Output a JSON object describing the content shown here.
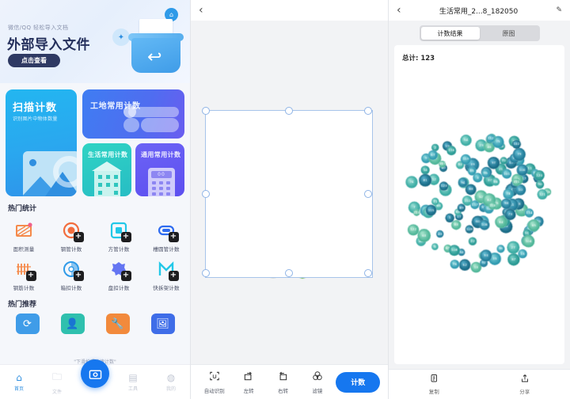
{
  "panel1": {
    "banner": {
      "subtitle": "微信/QQ 轻松导入文档",
      "title": "外部导入文件",
      "button": "点击查看",
      "art_icons": {
        "bubble_small": "✦",
        "bubble_doc": "⌂",
        "arrow": "↩"
      }
    },
    "cards": [
      {
        "id": "scan",
        "title": "扫描计数",
        "subtitle": "识别图片中物体数量",
        "color": "#23b6f0",
        "icon": "image-icon"
      },
      {
        "id": "site",
        "title": "工地常用计数",
        "color": "#3f7df2",
        "icon": "pipes-icon"
      },
      {
        "id": "life",
        "title": "生活常用计数",
        "color": "#2fd3c4",
        "icon": "building-icon"
      },
      {
        "id": "general",
        "title": "通用常用计数",
        "color": "#6c63f5",
        "icon": "calculator-icon"
      }
    ],
    "hot_stats": {
      "heading": "热门统计",
      "items": [
        {
          "label": "面积测量",
          "icon": "area-measure-icon",
          "color": "#f58a4b"
        },
        {
          "label": "钢管计数",
          "icon": "steel-pipe-icon",
          "color": "#f26d3d"
        },
        {
          "label": "方管计数",
          "icon": "square-pipe-icon",
          "color": "#22c8e8"
        },
        {
          "label": "槽圆管计数",
          "icon": "round-pipe-icon",
          "color": "#2f6cf0"
        },
        {
          "label": "钢筋计数",
          "icon": "rebar-icon",
          "color": "#f58a4b"
        },
        {
          "label": "箱扣计数",
          "icon": "buckle-icon",
          "color": "#2f9ae8"
        },
        {
          "label": "盘扣计数",
          "icon": "disc-buckle-icon",
          "color": "#4a5ef0"
        },
        {
          "label": "快拆架计数",
          "icon": "quick-frame-icon",
          "color": "#22c8e8"
        }
      ]
    },
    "hot_recommend": {
      "heading": "热门推荐",
      "items": [
        {
          "label": "",
          "icon": "transform-icon",
          "color": "#3f9ce8"
        },
        {
          "label": "",
          "icon": "person-icon",
          "color": "#2fc0ae"
        },
        {
          "label": "",
          "icon": "tool-icon",
          "color": "#f28a3c"
        },
        {
          "label": "",
          "icon": "photo-icon",
          "color": "#3f6de8"
        }
      ]
    },
    "fab": {
      "icon": "camera-icon",
      "caption": "\"下滑拍照快速计数\""
    },
    "tabbar": [
      {
        "label": "首页",
        "icon": "home-icon",
        "active": true
      },
      {
        "label": "文件",
        "icon": "folder-icon",
        "active": false
      },
      {
        "label": "",
        "icon": "",
        "active": false
      },
      {
        "label": "工具",
        "icon": "tools-icon",
        "active": false
      },
      {
        "label": "我的",
        "icon": "user-icon",
        "active": false
      }
    ]
  },
  "panel2": {
    "back_icon": "chevron-left-icon",
    "selection": {
      "handles": 8,
      "border_color": "#a7c4ea"
    },
    "toolbar": [
      {
        "label": "自动识别",
        "icon": "auto-detect-icon"
      },
      {
        "label": "左转",
        "icon": "rotate-left-icon"
      },
      {
        "label": "右转",
        "icon": "rotate-right-icon"
      },
      {
        "label": "滤镜",
        "icon": "filter-icon"
      }
    ],
    "primary_button": "计数"
  },
  "panel3": {
    "back_icon": "chevron-left-icon",
    "title": "生活常用_2...8_182050",
    "edit_icon": "pencil-icon",
    "tabs": [
      {
        "label": "计数结果",
        "active": true
      },
      {
        "label": "原图",
        "active": false
      }
    ],
    "total_label": "总计: 123",
    "total_count": 123,
    "actions": [
      {
        "label": "复制",
        "icon": "copy-icon"
      },
      {
        "label": "分享",
        "icon": "share-icon"
      }
    ]
  }
}
